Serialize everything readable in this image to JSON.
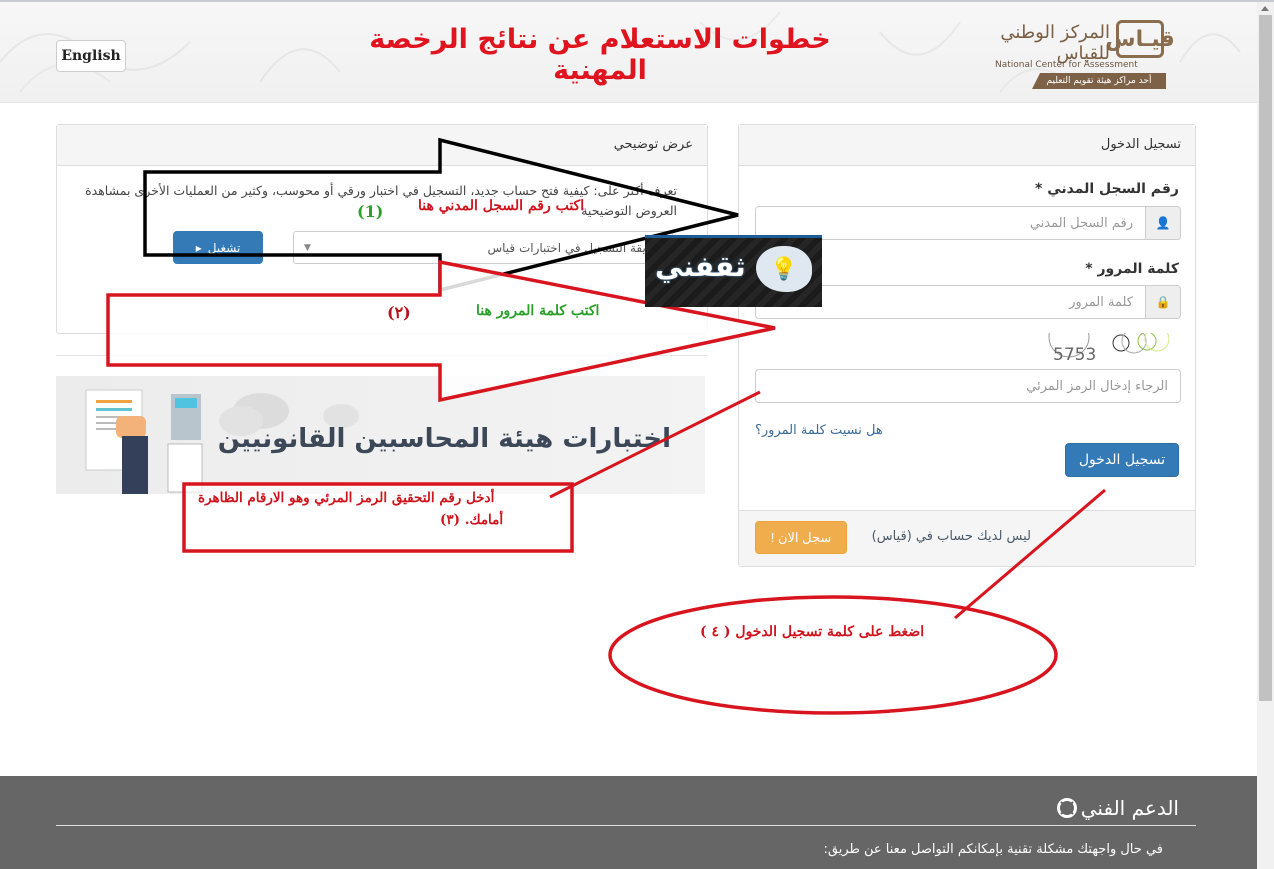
{
  "header": {
    "language_button": "English",
    "page_title": "خطوات الاستعلام عن نتائج الرخصة المهنية",
    "logo": {
      "mark": "قيـاس",
      "arabic_name": "المركز الوطني للقياس",
      "english_name": "National Center for Assessment",
      "ribbon": "أحد مراكز هيئة تقويم التعليم"
    }
  },
  "demo_panel": {
    "title": "عرض توضيحي",
    "description": "تعرف أكثر على: كيفية فتح حساب جديد، التسجيل في اختبار ورقي أو محوسب، وكثير من العمليات الأخرى بمشاهدة العروض التوضيحية",
    "play_button": "تشغيل",
    "select_value": "طريقة التسجيل في اختبارات قياس"
  },
  "banner": {
    "title": "اختبارات هيئة المحاسبين القانونيين"
  },
  "login_panel": {
    "title": "تسجيل الدخول",
    "civil_id_label": "رقم السجل المدني *",
    "civil_id_placeholder": "رقم السجل المدني",
    "civil_id_value": "",
    "password_label": "كلمة المرور *",
    "password_placeholder": "كلمة المرور",
    "password_value": "",
    "captcha_code": "5753",
    "captcha_placeholder": "الرجاء إدخال الرمز المرئي",
    "captcha_value": "",
    "forgot_password": "هل نسيت كلمة المرور؟",
    "login_button": "تسجيل الدخول",
    "no_account_text": "ليس لديك حساب في (قياس)",
    "register_button": "سجل الان !"
  },
  "footer": {
    "support_title": "الدعم الفني",
    "support_text": "في حال واجهتك مشكلة تقنية بإمكانكم التواصل معنا عن طريق:"
  },
  "annotations": {
    "step1_text": "اكتب رقم السجل المدني هنا",
    "step1_number": "(1)",
    "step2_text": "اكتب كلمة المرور هنا",
    "step2_number": "(٢)",
    "step3_text_line1": "أدخل رقم التحقيق الرمز المرئي وهو الارقام الظاهرة",
    "step3_text_line2": "أمامك.   (٣)",
    "step4_text": "اضغط على كلمة تسجيل الدخول ( ٤ )",
    "watermark": "ثقفني"
  },
  "colors": {
    "title_red": "#e0141e",
    "primary_blue": "#337ab7",
    "warning_orange": "#f0ad4e",
    "footer_gray": "#666666",
    "annotation_red": "#d0141e",
    "annotation_green": "#2aa02a"
  }
}
